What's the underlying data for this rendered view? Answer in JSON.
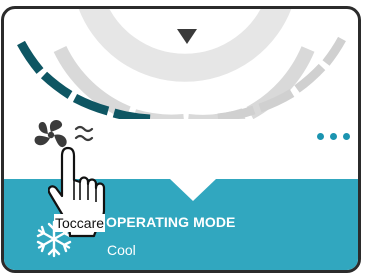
{
  "panel": {
    "mode_title": "OPERATING MODE",
    "mode_value": "Cool",
    "tooltip": "Toccare",
    "dial_filled_fraction": 0.3
  },
  "icons": {
    "fan": "fan-speed-icon",
    "more": "more-options-icon",
    "snow": "snowflake-icon",
    "pointer": "hand-pointer-icon",
    "indicator": "dial-indicator-icon"
  },
  "colors": {
    "accent": "#31a7bf",
    "dial_active": "#0e5663",
    "dial_inactive": "#d0d0d0",
    "dots": "#1b94b0"
  }
}
